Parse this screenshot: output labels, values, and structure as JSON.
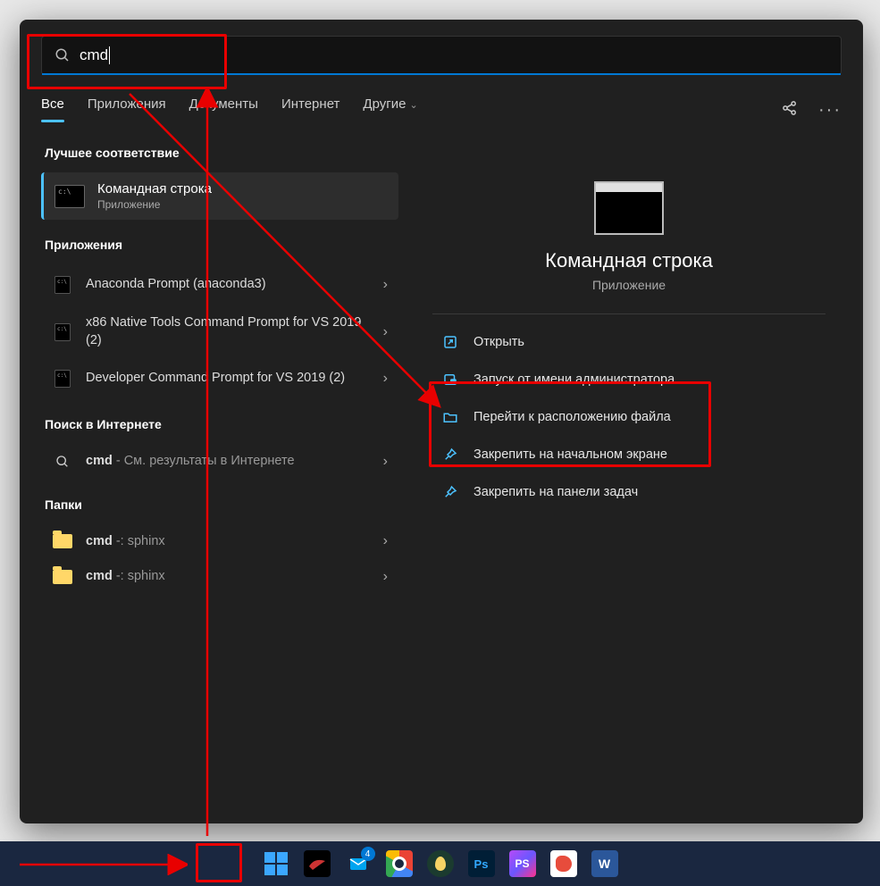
{
  "search": {
    "value": "cmd"
  },
  "tabs": [
    {
      "label": "Все",
      "active": true
    },
    {
      "label": "Приложения"
    },
    {
      "label": "Документы"
    },
    {
      "label": "Интернет"
    },
    {
      "label": "Другие",
      "dropdown": true
    }
  ],
  "sections": {
    "best_match_title": "Лучшее соответствие",
    "best_match": {
      "title": "Командная строка",
      "subtitle": "Приложение"
    },
    "apps_title": "Приложения",
    "apps": [
      {
        "label": "Anaconda Prompt (anaconda3)"
      },
      {
        "label": "x86 Native Tools Command Prompt for VS 2019 (2)"
      },
      {
        "label": "Developer Command Prompt for VS 2019 (2)"
      }
    ],
    "web_title": "Поиск в Интернете",
    "web": {
      "term": "cmd",
      "suffix": " - См. результаты в Интернете"
    },
    "folders_title": "Папки",
    "folders": [
      {
        "name": "cmd",
        "path": " -: sphinx"
      },
      {
        "name": "cmd",
        "path": " -: sphinx"
      }
    ]
  },
  "preview": {
    "title": "Командная строка",
    "type": "Приложение",
    "actions": [
      {
        "icon": "open",
        "label": "Открыть"
      },
      {
        "icon": "shield",
        "label": "Запуск от имени администратора"
      },
      {
        "icon": "folder",
        "label": "Перейти к расположению файла"
      },
      {
        "icon": "pin",
        "label": "Закрепить на начальном экране"
      },
      {
        "icon": "pin",
        "label": "Закрепить на панели задач"
      }
    ]
  },
  "taskbar": {
    "badge_count": "4",
    "icons": [
      "start",
      "kali",
      "mail",
      "chrome",
      "egg",
      "ps",
      "phpstorm",
      "paint",
      "word"
    ]
  },
  "annotations": {
    "boxes": [
      "search",
      "start",
      "actions"
    ],
    "arrows": [
      "start-to-search",
      "search-to-actions"
    ]
  },
  "colors": {
    "accent": "#4cc2ff",
    "highlight": "#e80000"
  }
}
